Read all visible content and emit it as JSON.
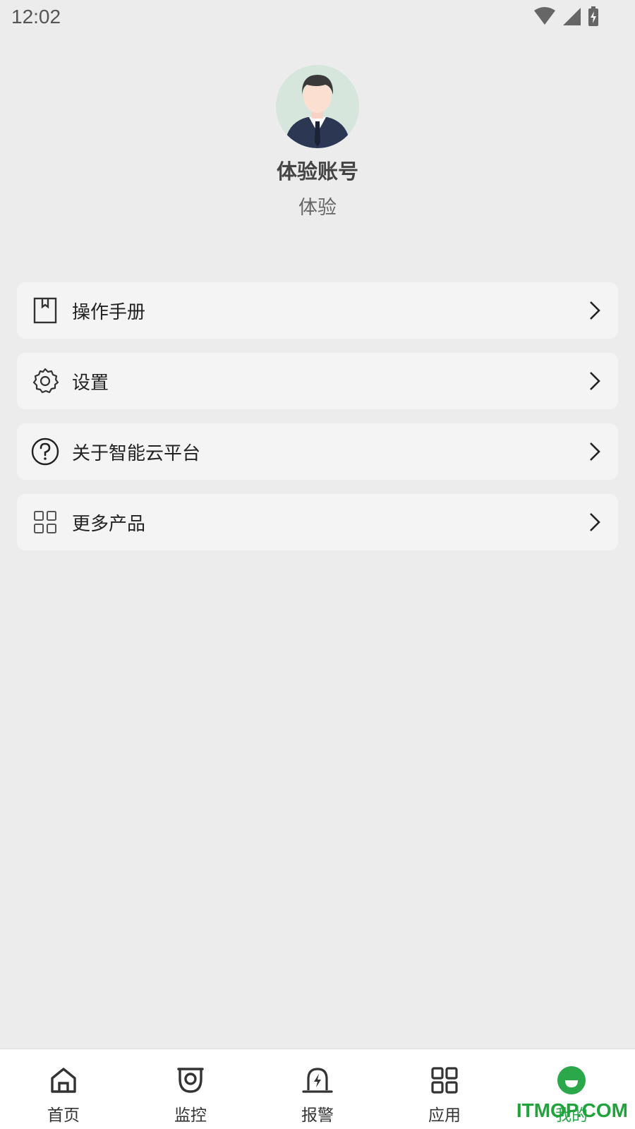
{
  "status_bar": {
    "time": "12:02",
    "icons": [
      "wifi-icon",
      "cellular-signal-icon",
      "battery-charging-icon"
    ]
  },
  "profile": {
    "name": "体验账号",
    "role": "体验"
  },
  "menu": {
    "items": [
      {
        "label": "操作手册",
        "icon": "manual-bookmark-icon"
      },
      {
        "label": "设置",
        "icon": "gear-icon"
      },
      {
        "label": "关于智能云平台",
        "icon": "help-circle-icon"
      },
      {
        "label": "更多产品",
        "icon": "grid-icon"
      }
    ]
  },
  "tabbar": {
    "tabs": [
      {
        "label": "首页",
        "icon": "home-icon",
        "active": false
      },
      {
        "label": "监控",
        "icon": "camera-icon",
        "active": false
      },
      {
        "label": "报警",
        "icon": "alarm-icon",
        "active": false
      },
      {
        "label": "应用",
        "icon": "apps-grid-icon",
        "active": false
      },
      {
        "label": "我的",
        "icon": "profile-icon",
        "active": true
      }
    ]
  },
  "watermark": "ITMOP.COM",
  "colors": {
    "accent": "#2aa84a",
    "background": "#ececec",
    "card": "#f4f4f4"
  }
}
